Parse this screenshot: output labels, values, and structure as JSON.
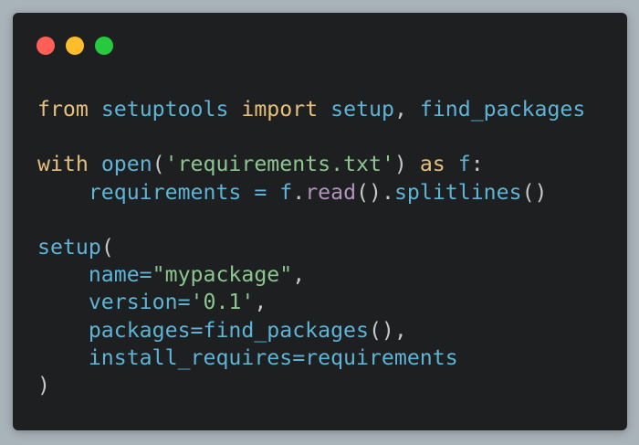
{
  "window": {
    "traffic_lights": [
      {
        "name": "close",
        "color": "#ff5f56"
      },
      {
        "name": "minimize",
        "color": "#ffbd2e"
      },
      {
        "name": "zoom",
        "color": "#27c93f"
      }
    ]
  },
  "colors": {
    "keyword": "#e6c07b",
    "identifier": "#5fb3d5",
    "string": "#8cc68f",
    "method": "#b294bb",
    "punctuation": "#c5c8c6",
    "background": "#1d1f21"
  },
  "code": {
    "lines": [
      [
        {
          "t": "kw",
          "v": "from"
        },
        {
          "t": "plain",
          "v": " "
        },
        {
          "t": "id",
          "v": "setuptools"
        },
        {
          "t": "plain",
          "v": " "
        },
        {
          "t": "kw",
          "v": "import"
        },
        {
          "t": "plain",
          "v": " "
        },
        {
          "t": "id",
          "v": "setup"
        },
        {
          "t": "plain",
          "v": ", "
        },
        {
          "t": "id",
          "v": "find_packages"
        }
      ],
      [],
      [
        {
          "t": "kw",
          "v": "with"
        },
        {
          "t": "plain",
          "v": " "
        },
        {
          "t": "id",
          "v": "open"
        },
        {
          "t": "plain",
          "v": "("
        },
        {
          "t": "str",
          "v": "'requirements.txt'"
        },
        {
          "t": "plain",
          "v": ") "
        },
        {
          "t": "kw",
          "v": "as"
        },
        {
          "t": "plain",
          "v": " "
        },
        {
          "t": "id",
          "v": "f"
        },
        {
          "t": "plain",
          "v": ":"
        }
      ],
      [
        {
          "t": "plain",
          "v": "    "
        },
        {
          "t": "id",
          "v": "requirements"
        },
        {
          "t": "plain",
          "v": " "
        },
        {
          "t": "id",
          "v": "="
        },
        {
          "t": "plain",
          "v": " "
        },
        {
          "t": "id",
          "v": "f"
        },
        {
          "t": "plain",
          "v": "."
        },
        {
          "t": "fn",
          "v": "read"
        },
        {
          "t": "plain",
          "v": "()."
        },
        {
          "t": "id",
          "v": "splitlines"
        },
        {
          "t": "plain",
          "v": "()"
        }
      ],
      [],
      [
        {
          "t": "id",
          "v": "setup"
        },
        {
          "t": "plain",
          "v": "("
        }
      ],
      [
        {
          "t": "plain",
          "v": "    "
        },
        {
          "t": "id",
          "v": "name="
        },
        {
          "t": "str",
          "v": "\"mypackage\""
        },
        {
          "t": "plain",
          "v": ","
        }
      ],
      [
        {
          "t": "plain",
          "v": "    "
        },
        {
          "t": "id",
          "v": "version="
        },
        {
          "t": "str",
          "v": "'0.1'"
        },
        {
          "t": "plain",
          "v": ","
        }
      ],
      [
        {
          "t": "plain",
          "v": "    "
        },
        {
          "t": "id",
          "v": "packages=find_packages"
        },
        {
          "t": "plain",
          "v": "(),"
        }
      ],
      [
        {
          "t": "plain",
          "v": "    "
        },
        {
          "t": "id",
          "v": "install_requires=requirements"
        }
      ],
      [
        {
          "t": "plain",
          "v": ")"
        }
      ]
    ]
  }
}
